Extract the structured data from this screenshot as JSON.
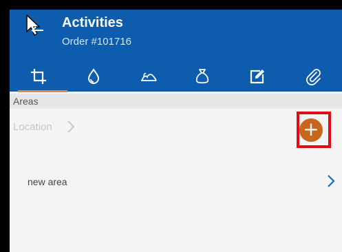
{
  "header": {
    "title": "Activities",
    "subtitle": "Order #101716",
    "back_icon": "cursor-arrow-back-icon",
    "background_color": "#0e5cad"
  },
  "tabs": [
    {
      "icon": "crop-icon",
      "active": true
    },
    {
      "icon": "water-drop-icon",
      "active": false
    },
    {
      "icon": "field-hills-icon",
      "active": false
    },
    {
      "icon": "sack-bag-icon",
      "active": false
    },
    {
      "icon": "edit-note-icon",
      "active": false
    },
    {
      "icon": "paperclip-attachment-icon",
      "active": false
    }
  ],
  "active_tab_underline_color": "#e08a4a",
  "section": {
    "title": "Areas"
  },
  "location": {
    "label": "Location"
  },
  "add_button": {
    "icon": "plus-icon",
    "label": "+",
    "color": "#c8661f",
    "highlight_color": "#e30b13"
  },
  "areas": [
    {
      "label": "new area"
    }
  ]
}
